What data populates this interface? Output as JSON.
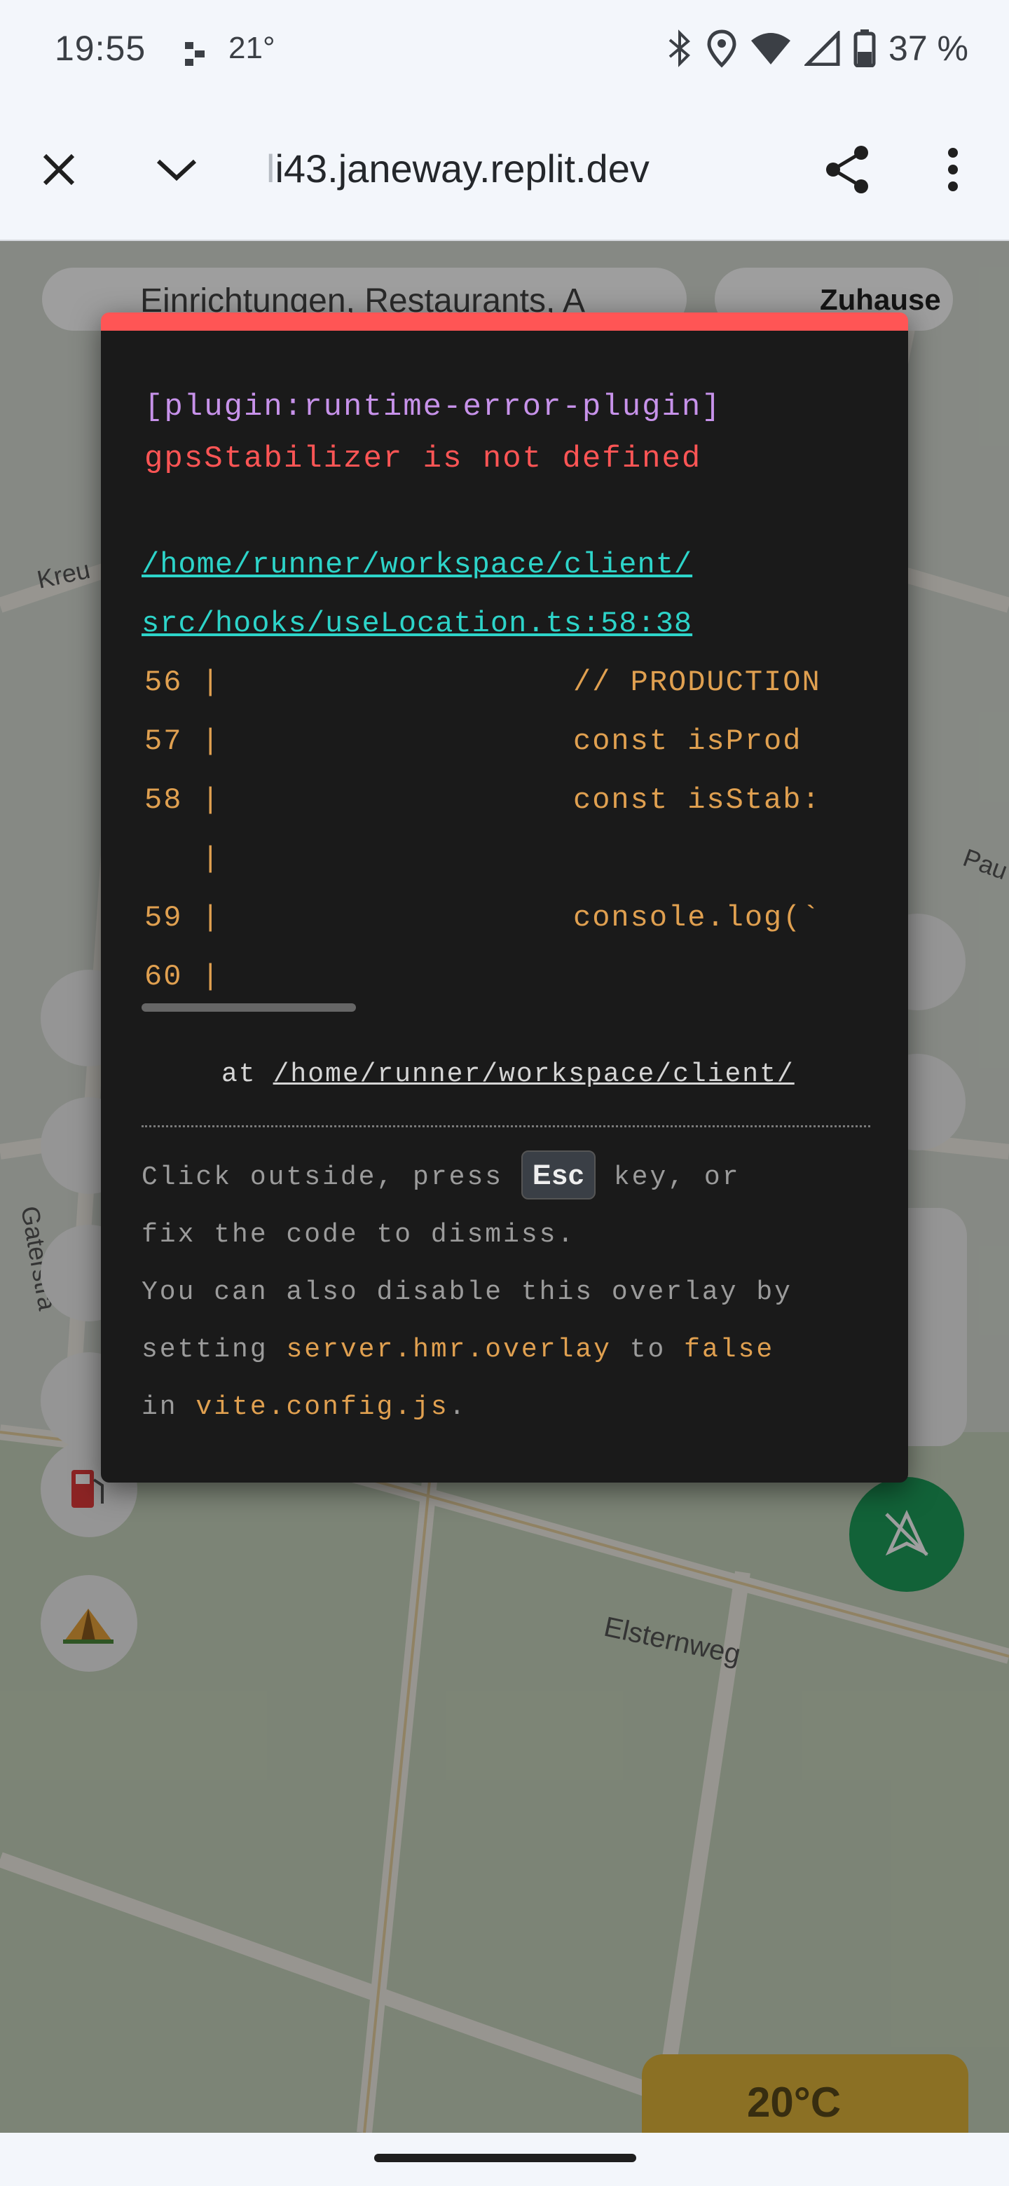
{
  "status_bar": {
    "time": "19:55",
    "temperature": "21°",
    "battery": "37 %"
  },
  "browser": {
    "url_fade": "l",
    "url": "i43.janeway.replit.dev"
  },
  "map_labels": {
    "street_1": "Kreu",
    "street_2": "Pau",
    "street_3": "Gaterstra",
    "street_4": "Elsternweg",
    "search_hint": "Einrichtungen, Restaurants, A",
    "button_hint": "Zuhause",
    "temperature_chip": "20°C"
  },
  "error_overlay": {
    "plugin": "[plugin:runtime-error-plugin]",
    "message": "gpsStabilizer is not defined",
    "file_line1": "/home/runner/workspace/client/",
    "file_line2": "src/hooks/useLocation.ts:58:38",
    "code_lines": [
      {
        "num": "56 |",
        "code": "// PRODUCTION"
      },
      {
        "num": "57 |",
        "code": "const isProd"
      },
      {
        "num": "58 |",
        "code": "const isStab:"
      },
      {
        "num": "   |",
        "code": ""
      },
      {
        "num": "59 |",
        "code": "console.log(`"
      },
      {
        "num": "60 |",
        "code": ""
      }
    ],
    "stack_prefix": "at",
    "stack_link": "/home/runner/workspace/client/",
    "tip_1": "Click outside, press",
    "tip_key": "Esc",
    "tip_2": "key, or",
    "tip_3": "fix the code to dismiss.",
    "tip_4": "You can also disable this overlay by",
    "tip_5": "setting",
    "tip_setting": "server.hmr.overlay",
    "tip_6": "to",
    "tip_false": "false",
    "tip_7": "in",
    "tip_file": "vite.config.js",
    "tip_8": "."
  },
  "colors": {
    "overlay_bg": "#1a1a1a",
    "error_red": "#ff5555",
    "plugin_purple": "#c792ea",
    "link_cyan": "#2dd4c9",
    "code_orange": "#e0a050"
  }
}
